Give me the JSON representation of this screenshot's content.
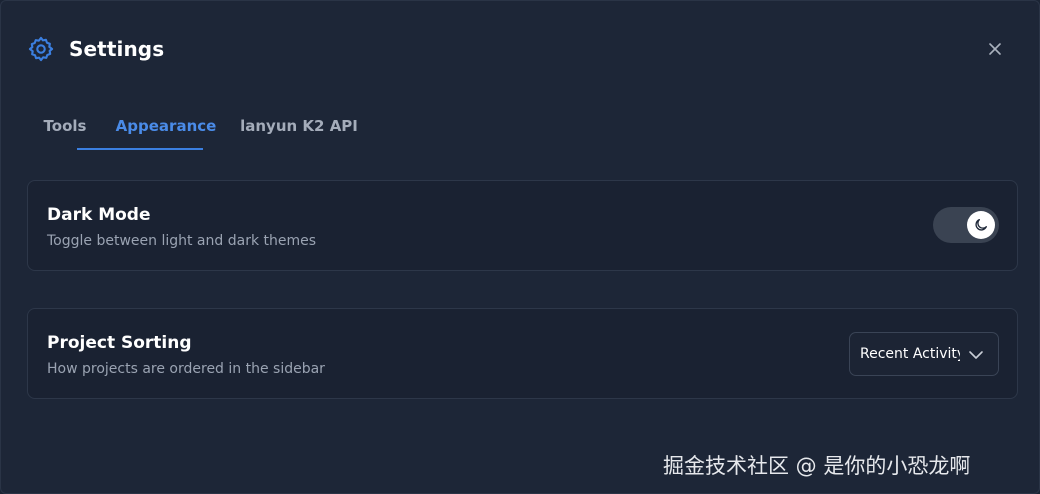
{
  "dialog": {
    "title": "Settings",
    "icon": "gear-icon",
    "close_icon": "close-icon"
  },
  "tabs": [
    {
      "label": "Tools",
      "active": false
    },
    {
      "label": "Appearance",
      "active": true
    },
    {
      "label": "lanyun K2 API",
      "active": false
    }
  ],
  "dark_mode": {
    "label": "Dark Mode",
    "description": "Toggle between light and dark themes",
    "enabled": true,
    "icon": "moon-icon"
  },
  "project_sorting": {
    "label": "Project Sorting",
    "description": "How projects are ordered in the sidebar",
    "selected": "Recent Activity",
    "icon": "chevron-down-icon"
  },
  "watermark": "掘金技术社区 @ 是你的小恐龙啊",
  "colors": {
    "accent": "#3b7fe0",
    "background": "#1d2637",
    "card": "#1a2232"
  }
}
